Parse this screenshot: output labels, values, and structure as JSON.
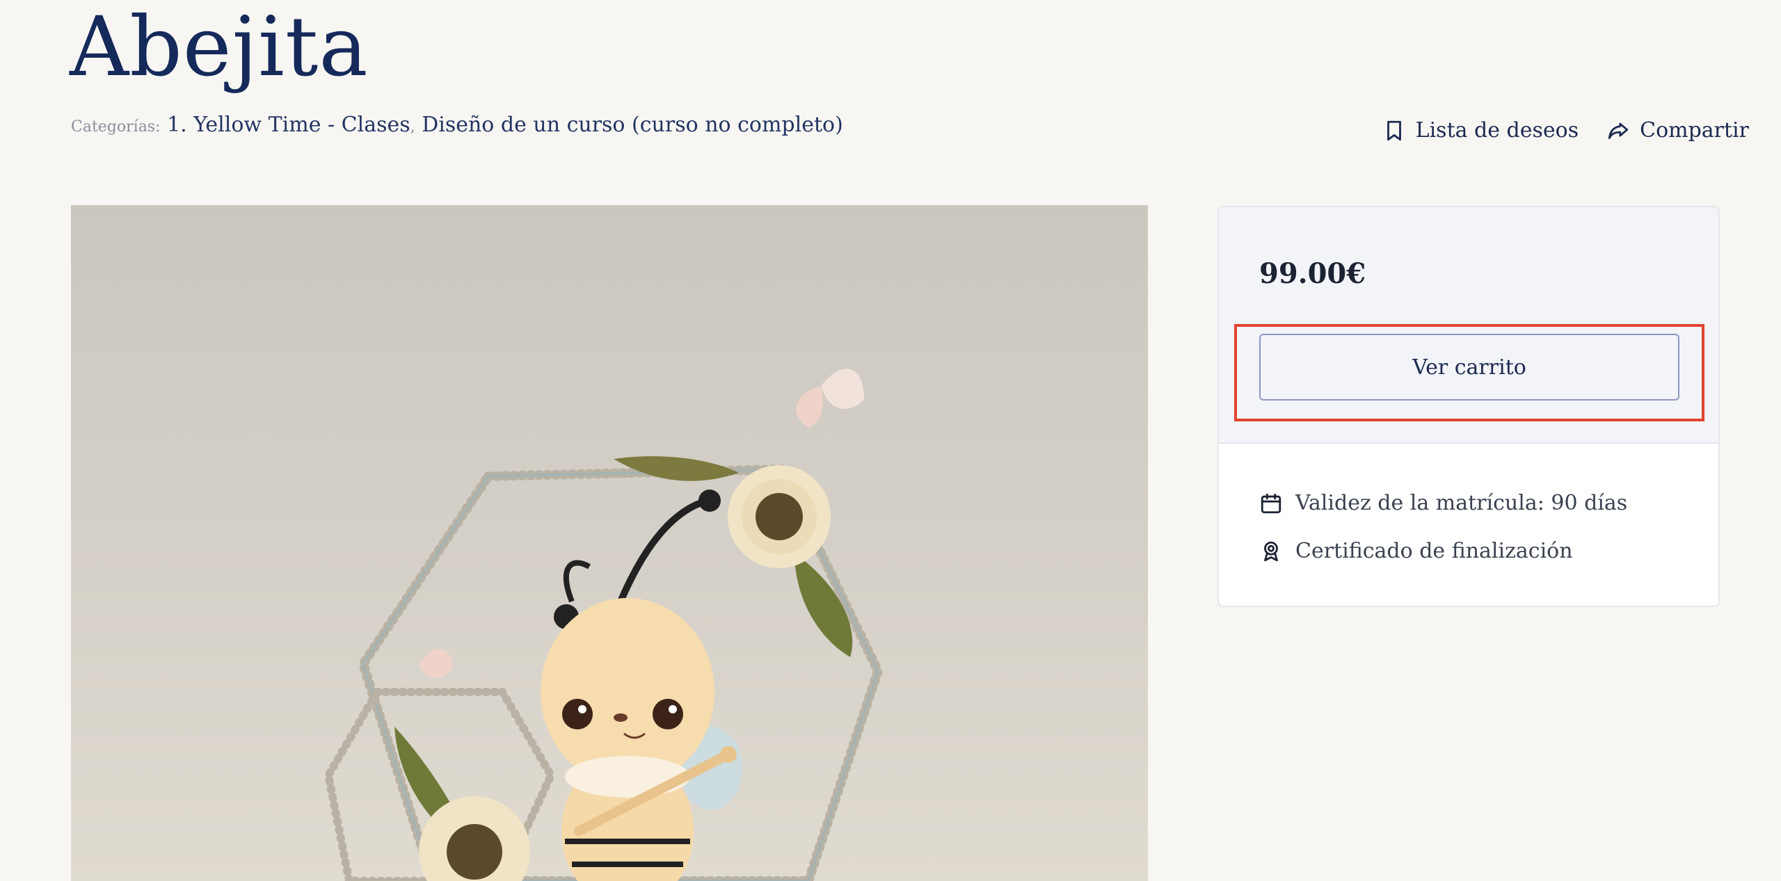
{
  "course": {
    "title": "Abejita",
    "categories_label": "Categorías:",
    "categories": [
      "1. Yellow Time - Clases",
      "Diseño de un curso (curso no completo)"
    ],
    "category_separator": ","
  },
  "actions": {
    "wishlist_label": "Lista de deseos",
    "share_label": "Compartir"
  },
  "purchase": {
    "price": "99.00€",
    "cart_button_label": "Ver carrito",
    "highlight_color": "#e0432e"
  },
  "features": [
    {
      "icon": "calendar-icon",
      "label": "Validez de la matrícula: 90 días"
    },
    {
      "icon": "certificate-icon",
      "label": "Certificado de finalización"
    }
  ],
  "hero_image": {
    "subject": "bee-sugar-figure-with-sunflowers"
  }
}
